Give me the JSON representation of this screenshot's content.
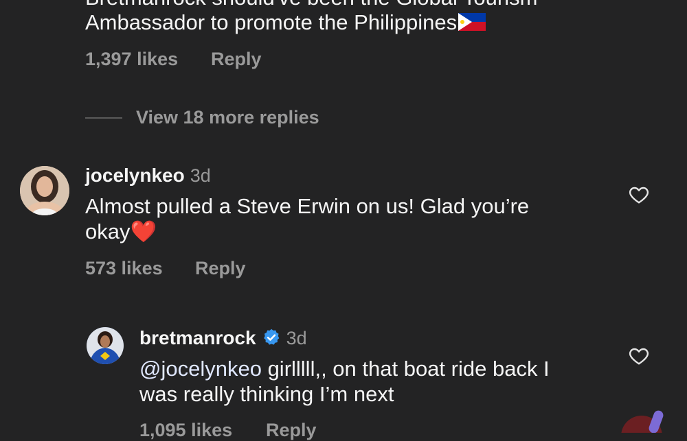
{
  "comment1": {
    "text_line1_partial": "Bretmanrock should've been the Global Tourism",
    "text_line2": "Ambassador to promote the Philippines",
    "flag_icon": "philippines-flag-icon",
    "likes": "1,397 likes",
    "reply": "Reply",
    "view_more": "View 18 more replies"
  },
  "comment2": {
    "username": "jocelynkeo",
    "time": "3d",
    "text_line1": "Almost pulled a Steve Erwin on us! Glad you’re",
    "text_line2": "okay",
    "emoji": "❤️",
    "likes": "573 likes",
    "reply": "Reply"
  },
  "comment3": {
    "username": "bretmanrock",
    "time": "3d",
    "mention": "@jocelynkeo",
    "text_line1_rest": " girlllll,, on that boat ride back I",
    "text_line2": "was really thinking I’m next",
    "likes": "1,095 likes",
    "reply": "Reply"
  },
  "colors": {
    "background": "#232324",
    "text": "#f5f5f5",
    "muted": "#9a9a9a",
    "verified": "#3897f0"
  }
}
